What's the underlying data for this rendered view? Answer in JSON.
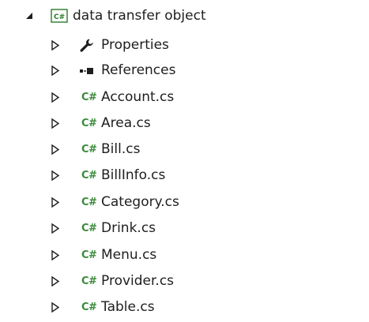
{
  "solution_explorer": {
    "project": {
      "name": "data transfer object",
      "icon": "csharp-project-icon",
      "icon_text": "C#",
      "expanded": true
    },
    "children": [
      {
        "label": "Properties",
        "icon": "wrench-icon",
        "expanded": false
      },
      {
        "label": "References",
        "icon": "references-icon",
        "expanded": false
      },
      {
        "label": "Account.cs",
        "icon": "csharp-file-icon",
        "icon_text": "C#",
        "expanded": false
      },
      {
        "label": "Area.cs",
        "icon": "csharp-file-icon",
        "icon_text": "C#",
        "expanded": false
      },
      {
        "label": "Bill.cs",
        "icon": "csharp-file-icon",
        "icon_text": "C#",
        "expanded": false
      },
      {
        "label": "BillInfo.cs",
        "icon": "csharp-file-icon",
        "icon_text": "C#",
        "expanded": false
      },
      {
        "label": "Category.cs",
        "icon": "csharp-file-icon",
        "icon_text": "C#",
        "expanded": false
      },
      {
        "label": "Drink.cs",
        "icon": "csharp-file-icon",
        "icon_text": "C#",
        "expanded": false
      },
      {
        "label": "Menu.cs",
        "icon": "csharp-file-icon",
        "icon_text": "C#",
        "expanded": false
      },
      {
        "label": "Provider.cs",
        "icon": "csharp-file-icon",
        "icon_text": "C#",
        "expanded": false
      },
      {
        "label": "Table.cs",
        "icon": "csharp-file-icon",
        "icon_text": "C#",
        "expanded": false
      }
    ],
    "colors": {
      "text": "#1e1e1e",
      "csharp_green": "#3a8a3a",
      "arrow": "#1e1e1e",
      "background": "#ffffff"
    }
  }
}
